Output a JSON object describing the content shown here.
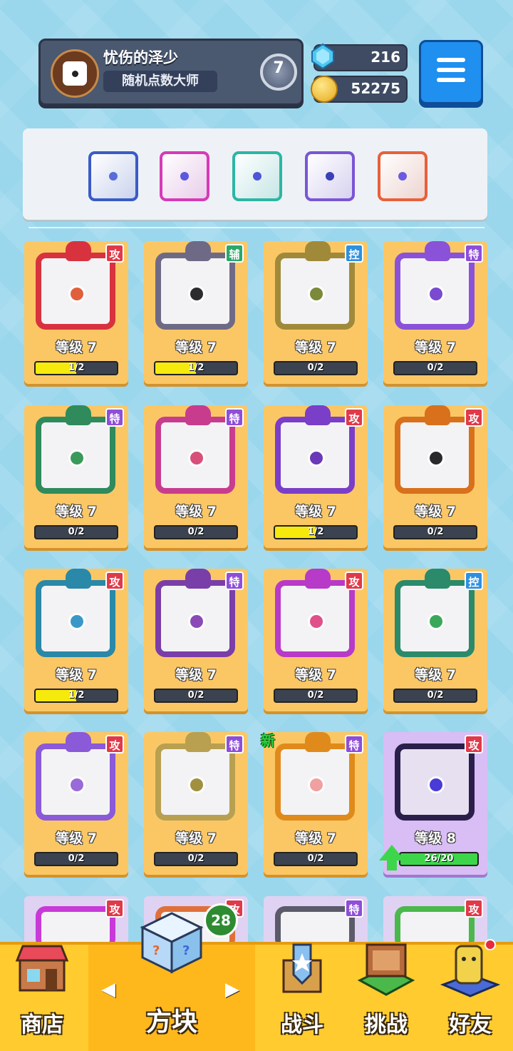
{
  "profile": {
    "name": "忧伤的泽少",
    "title": "随机点数大师",
    "rank": "7"
  },
  "currency": {
    "gems": "216",
    "coins": "52275"
  },
  "deck": {
    "slots": [
      {
        "icon": "gear-dice-icon",
        "color": "#3a5bc7",
        "dot": "#5a6cd8"
      },
      {
        "icon": "swap-dice-icon",
        "color": "#d63ab8",
        "dot": "#5c58e0"
      },
      {
        "icon": "hands-dice-icon",
        "color": "#2cb6a4",
        "dot": "#4b55d8"
      },
      {
        "icon": "crack-dice-icon",
        "color": "#7a55d6",
        "dot": "#3b3fb8"
      },
      {
        "icon": "rainbow-dice-icon",
        "color": "#e8603a",
        "dot": "#6a5ce0"
      }
    ]
  },
  "cards": [
    {
      "tag": "攻",
      "tagColor": "#e03a4a",
      "level": "等级 7",
      "progress": "1/2",
      "fill": 0.5,
      "frame": "#d8323f",
      "dot": "#e0603c",
      "icon": "sun-dice-icon"
    },
    {
      "tag": "辅",
      "tagColor": "#2aa86a",
      "level": "等级 7",
      "progress": "1/2",
      "fill": 0.5,
      "frame": "#6e6a86",
      "dot": "#2c2c2c",
      "icon": "mouth-dice-icon"
    },
    {
      "tag": "控",
      "tagColor": "#2d90e0",
      "level": "等级 7",
      "progress": "0/2",
      "fill": 0,
      "frame": "#a08a3a",
      "dot": "#7a8a3a",
      "icon": "lock-dice-icon"
    },
    {
      "tag": "特",
      "tagColor": "#8e4ed8",
      "level": "等级 7",
      "progress": "0/2",
      "fill": 0,
      "frame": "#8a52d8",
      "dot": "#7a4ad0",
      "icon": "orbit-dice-icon"
    },
    {
      "tag": "特",
      "tagColor": "#8e4ed8",
      "level": "等级 7",
      "progress": "0/2",
      "fill": 0,
      "frame": "#2f8a5c",
      "dot": "#3a9a5a",
      "icon": "pentagram-dice-icon"
    },
    {
      "tag": "特",
      "tagColor": "#8e4ed8",
      "level": "等级 7",
      "progress": "0/2",
      "fill": 0,
      "frame": "#c83c8e",
      "dot": "#d8507a",
      "icon": "syringe-dice-icon"
    },
    {
      "tag": "攻",
      "tagColor": "#e03a4a",
      "level": "等级 7",
      "progress": "1/2",
      "fill": 0.5,
      "frame": "#7a3ec8",
      "dot": "#6a3ab8",
      "icon": "atom-dice-icon"
    },
    {
      "tag": "攻",
      "tagColor": "#e03a4a",
      "level": "等级 7",
      "progress": "0/2",
      "fill": 0,
      "frame": "#d8701c",
      "dot": "#2a2a2a",
      "icon": "gun-dice-icon"
    },
    {
      "tag": "攻",
      "tagColor": "#e03a4a",
      "level": "等级 7",
      "progress": "1/2",
      "fill": 0.5,
      "frame": "#2a88a8",
      "dot": "#3a98c8",
      "icon": "vortex-dice-icon"
    },
    {
      "tag": "特",
      "tagColor": "#8e4ed8",
      "level": "等级 7",
      "progress": "0/2",
      "fill": 0,
      "frame": "#7a3ea8",
      "dot": "#8a4ab8",
      "icon": "shadow-dice-icon"
    },
    {
      "tag": "攻",
      "tagColor": "#e03a4a",
      "level": "等级 7",
      "progress": "0/2",
      "fill": 0,
      "frame": "#b83ac8",
      "dot": "#e0508a",
      "icon": "combo-dice-icon"
    },
    {
      "tag": "控",
      "tagColor": "#2d90e0",
      "level": "等级 7",
      "progress": "0/2",
      "fill": 0,
      "frame": "#2a8a6a",
      "dot": "#3aa85a",
      "icon": "wave-dice-icon"
    },
    {
      "tag": "攻",
      "tagColor": "#e03a4a",
      "level": "等级 7",
      "progress": "0/2",
      "fill": 0,
      "frame": "#8a5ad8",
      "dot": "#9a6ad8",
      "icon": "star-dice-icon"
    },
    {
      "tag": "特",
      "tagColor": "#8e4ed8",
      "level": "等级 7",
      "progress": "0/2",
      "fill": 0,
      "frame": "#b8a050",
      "dot": "#a09040",
      "icon": "crest-dice-icon"
    },
    {
      "tag": "特",
      "tagColor": "#8e4ed8",
      "level": "等级 7",
      "progress": "0/2",
      "fill": 0,
      "frame": "#e08a1c",
      "dot": "#f0a0a0",
      "icon": "heart-dice-icon",
      "new": "新"
    },
    {
      "tag": "攻",
      "tagColor": "#e03a4a",
      "level": "等级 8",
      "progress": "26/20",
      "fill": 1,
      "frame": "#2a1f4a",
      "dot": "#4a3ad8",
      "icon": "comet-dice-icon",
      "special": true
    }
  ],
  "partial_row": [
    {
      "tag": "攻",
      "tagColor": "#e03a4a",
      "frame": "#c83ad8"
    },
    {
      "tag": "攻",
      "tagColor": "#e03a4a",
      "frame": "#e0703a"
    },
    {
      "tag": "特",
      "tagColor": "#8e4ed8",
      "frame": "#5a5a6a"
    },
    {
      "tag": "攻",
      "tagColor": "#e03a4a",
      "frame": "#4ab84a"
    }
  ],
  "nav": {
    "shop": "商店",
    "dice": "方块",
    "battle": "战斗",
    "challenge": "挑战",
    "friends": "好友",
    "dice_badge": "28"
  }
}
